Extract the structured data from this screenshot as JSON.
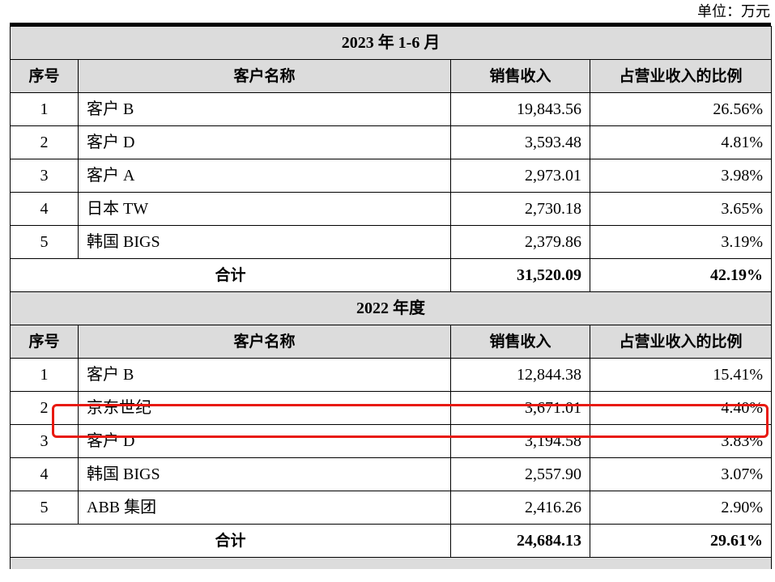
{
  "unit_label": "单位：万元",
  "headers": {
    "index": "序号",
    "customer": "客户名称",
    "revenue": "销售收入",
    "share": "占营业收入的比例"
  },
  "sections": [
    {
      "title": "2023 年 1-6 月",
      "rows": [
        {
          "index": "1",
          "customer": "客户 B",
          "revenue": "19,843.56",
          "share": "26.56%"
        },
        {
          "index": "2",
          "customer": "客户 D",
          "revenue": "3,593.48",
          "share": "4.81%"
        },
        {
          "index": "3",
          "customer": "客户 A",
          "revenue": "2,973.01",
          "share": "3.98%"
        },
        {
          "index": "4",
          "customer": "日本 TW",
          "revenue": "2,730.18",
          "share": "3.65%"
        },
        {
          "index": "5",
          "customer": "韩国 BIGS",
          "revenue": "2,379.86",
          "share": "3.19%"
        }
      ],
      "total": {
        "label": "合计",
        "revenue": "31,520.09",
        "share": "42.19%"
      }
    },
    {
      "title": "2022 年度",
      "rows": [
        {
          "index": "1",
          "customer": "客户 B",
          "revenue": "12,844.38",
          "share": "15.41%"
        },
        {
          "index": "2",
          "customer": "京东世纪",
          "revenue": "3,671.01",
          "share": "4.40%"
        },
        {
          "index": "3",
          "customer": "客户 D",
          "revenue": "3,194.58",
          "share": "3.83%"
        },
        {
          "index": "4",
          "customer": "韩国 BIGS",
          "revenue": "2,557.90",
          "share": "3.07%"
        },
        {
          "index": "5",
          "customer": "ABB 集团",
          "revenue": "2,416.26",
          "share": "2.90%"
        }
      ],
      "total": {
        "label": "合计",
        "revenue": "24,684.13",
        "share": "29.61%"
      }
    }
  ],
  "highlight_color": "#e8190f"
}
